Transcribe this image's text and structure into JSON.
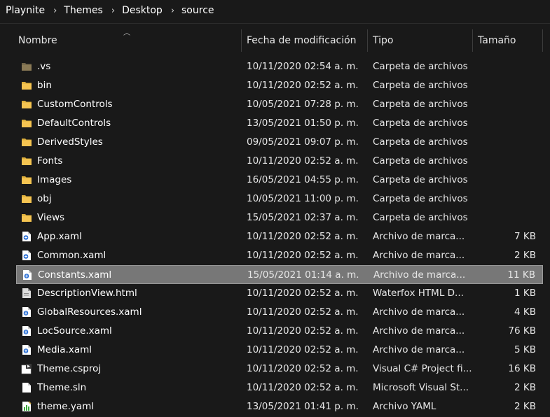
{
  "breadcrumb": [
    "Playnite",
    "Themes",
    "Desktop",
    "source"
  ],
  "columns": {
    "name": "Nombre",
    "date": "Fecha de modificación",
    "type": "Tipo",
    "size": "Tamaño"
  },
  "colors": {
    "background": "#191919",
    "selected_row": "#777777",
    "folder": "#f5c451",
    "vs_folder": "#8a7a56"
  },
  "rows": [
    {
      "name": ".vs",
      "date": "10/11/2020 02:54 a. m.",
      "type": "Carpeta de archivos",
      "size": "",
      "icon": "hidden-folder-icon"
    },
    {
      "name": "bin",
      "date": "10/11/2020 02:52 a. m.",
      "type": "Carpeta de archivos",
      "size": "",
      "icon": "folder-icon"
    },
    {
      "name": "CustomControls",
      "date": "10/05/2021 07:28 p. m.",
      "type": "Carpeta de archivos",
      "size": "",
      "icon": "folder-icon"
    },
    {
      "name": "DefaultControls",
      "date": "13/05/2021 01:50 p. m.",
      "type": "Carpeta de archivos",
      "size": "",
      "icon": "folder-icon"
    },
    {
      "name": "DerivedStyles",
      "date": "09/05/2021 09:07 p. m.",
      "type": "Carpeta de archivos",
      "size": "",
      "icon": "folder-icon"
    },
    {
      "name": "Fonts",
      "date": "10/11/2020 02:52 a. m.",
      "type": "Carpeta de archivos",
      "size": "",
      "icon": "folder-icon"
    },
    {
      "name": "Images",
      "date": "16/05/2021 04:55 p. m.",
      "type": "Carpeta de archivos",
      "size": "",
      "icon": "folder-icon"
    },
    {
      "name": "obj",
      "date": "10/05/2021 11:00 p. m.",
      "type": "Carpeta de archivos",
      "size": "",
      "icon": "folder-icon"
    },
    {
      "name": "Views",
      "date": "15/05/2021 02:37 a. m.",
      "type": "Carpeta de archivos",
      "size": "",
      "icon": "folder-icon"
    },
    {
      "name": "App.xaml",
      "date": "10/11/2020 02:52 a. m.",
      "type": "Archivo de marca...",
      "size": "7 KB",
      "icon": "xaml-file-icon"
    },
    {
      "name": "Common.xaml",
      "date": "10/11/2020 02:52 a. m.",
      "type": "Archivo de marca...",
      "size": "2 KB",
      "icon": "xaml-file-icon"
    },
    {
      "name": "Constants.xaml",
      "date": "15/05/2021 01:14 a. m.",
      "type": "Archivo de marca...",
      "size": "11 KB",
      "icon": "xaml-file-icon",
      "selected": true
    },
    {
      "name": "DescriptionView.html",
      "date": "10/11/2020 02:52 a. m.",
      "type": "Waterfox HTML D...",
      "size": "1 KB",
      "icon": "html-file-icon"
    },
    {
      "name": "GlobalResources.xaml",
      "date": "10/11/2020 02:52 a. m.",
      "type": "Archivo de marca...",
      "size": "4 KB",
      "icon": "xaml-file-icon"
    },
    {
      "name": "LocSource.xaml",
      "date": "10/11/2020 02:52 a. m.",
      "type": "Archivo de marca...",
      "size": "76 KB",
      "icon": "xaml-file-icon"
    },
    {
      "name": "Media.xaml",
      "date": "10/11/2020 02:52 a. m.",
      "type": "Archivo de marca...",
      "size": "5 KB",
      "icon": "xaml-file-icon"
    },
    {
      "name": "Theme.csproj",
      "date": "10/11/2020 02:52 a. m.",
      "type": "Visual C# Project fi...",
      "size": "16 KB",
      "icon": "csproj-file-icon"
    },
    {
      "name": "Theme.sln",
      "date": "10/11/2020 02:52 a. m.",
      "type": "Microsoft Visual St...",
      "size": "2 KB",
      "icon": "sln-file-icon"
    },
    {
      "name": "theme.yaml",
      "date": "13/05/2021 01:41 p. m.",
      "type": "Archivo YAML",
      "size": "2 KB",
      "icon": "yaml-file-icon"
    }
  ]
}
